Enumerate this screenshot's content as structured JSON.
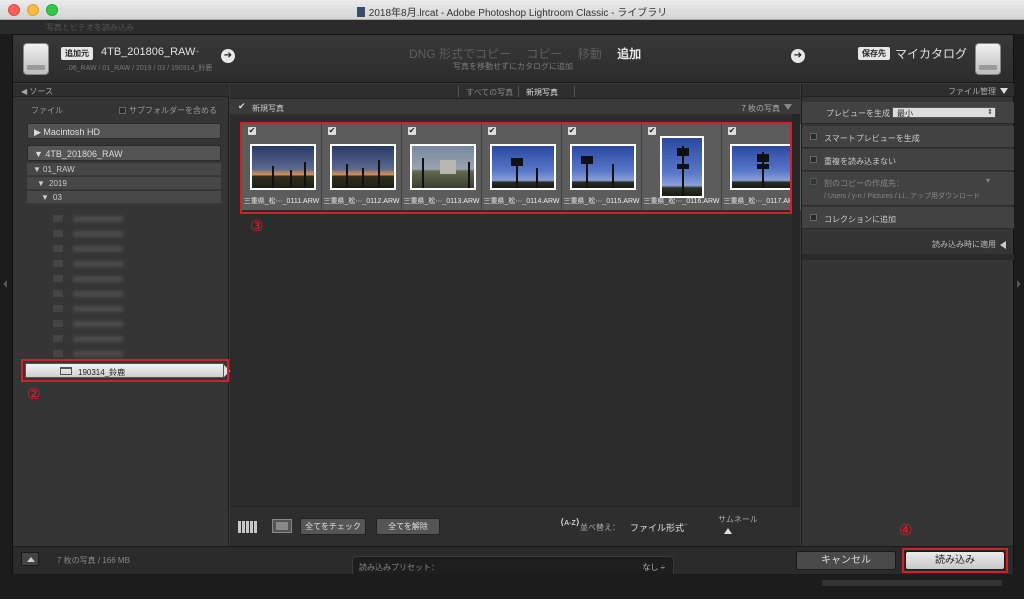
{
  "window": {
    "title": "2018年8月.lrcat - Adobe Photoshop Lightroom Classic - ライブラリ"
  },
  "background_text": "写真とビデオを読み込み",
  "header": {
    "source_tag": "追加元",
    "source_name": "4TB_201806_RAW",
    "source_caret": "÷",
    "source_path": "...06_RAW / 01_RAW / 2019 / 03 / 190314_鈴鹿",
    "modes": [
      "DNG 形式でコピー",
      "コピー",
      "移動",
      "追加"
    ],
    "active_mode": "追加",
    "mode_subtitle": "写真を移動せずにカタログに追加",
    "dest_tag": "保存先",
    "dest_name": "マイカタログ"
  },
  "left_panel": {
    "section_title": "ソース",
    "file_label": "ファイル",
    "subfolder_label": "サブフォルダーを含める",
    "volumes": [
      {
        "label": "Macintosh HD",
        "expanded": false
      },
      {
        "label": "4TB_201806_RAW",
        "expanded": true
      }
    ],
    "tree": [
      "01_RAW",
      "2019",
      "03"
    ],
    "selected_folder": "190314_鈴鹿",
    "annotation": "②"
  },
  "center": {
    "tabs": [
      "すべての写真",
      "新規写真"
    ],
    "active_tab": "新規写真",
    "new_photos_label": "新規写真",
    "photo_count": "7 枚の写真",
    "photos": [
      {
        "caption": "三重県_松⋯_0111.ARW",
        "orientation": "land",
        "sky": "dusk"
      },
      {
        "caption": "三重県_松⋯_0112.ARW",
        "orientation": "land",
        "sky": "dusk"
      },
      {
        "caption": "三重県_松⋯_0113.ARW",
        "orientation": "land",
        "sky": "grey"
      },
      {
        "caption": "三重県_松⋯_0114.ARW",
        "orientation": "land",
        "sky": "blue"
      },
      {
        "caption": "三重県_松⋯_0115.ARW",
        "orientation": "land",
        "sky": "blue"
      },
      {
        "caption": "三重県_松⋯_0116.ARW",
        "orientation": "port",
        "sky": "blue"
      },
      {
        "caption": "三重県_松⋯_0117.ARW",
        "orientation": "land",
        "sky": "blue"
      }
    ],
    "annotation": "③",
    "toolbar": {
      "check_all": "全てをチェック",
      "uncheck_all": "全てを解除",
      "sort_icon": "A-Z",
      "sort_label": "並べ替え：",
      "sort_value": "ファイル形式",
      "sort_caret": "÷",
      "thumbnail_label": "サムネール"
    }
  },
  "right_panel": {
    "section_title": "ファイル管理",
    "preview_label": "プレビューを生成",
    "preview_value": "最小",
    "smart_preview": "スマートプレビューを生成",
    "no_duplicates": "重複を読み込まない",
    "second_copy_label": "別のコピーの作成先：",
    "second_copy_path": "/ Users / y-n / Pictures / Li...アップ用ダウンロード",
    "add_to_collection": "コレクションに追加",
    "apply_on_import": "読み込み時に適用"
  },
  "footer": {
    "info": "7 枚の写真 / 166 MB",
    "preset_label": "読み込みプリセット：",
    "preset_value": "なし ÷",
    "cancel": "キャンセル",
    "import": "読み込み",
    "annotation": "④"
  },
  "colors": {
    "annotation_red": "#d0202a",
    "panel_bg": "#3a3a3a"
  }
}
